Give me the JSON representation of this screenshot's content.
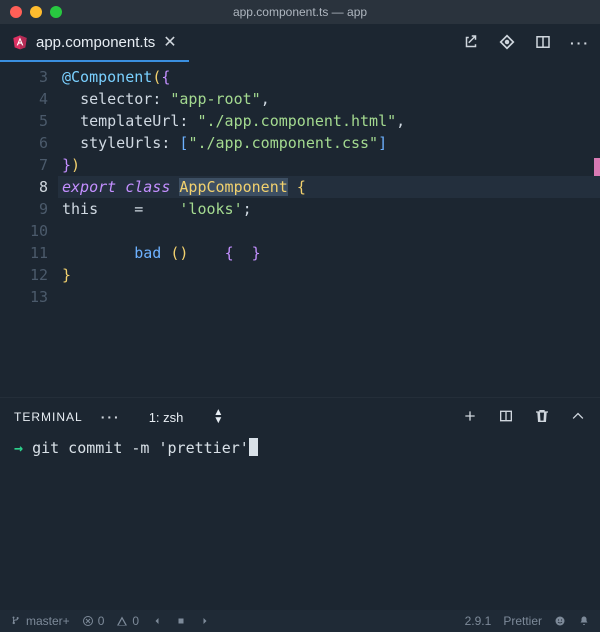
{
  "window": {
    "title": "app.component.ts — app"
  },
  "tab": {
    "filename": "app.component.ts",
    "dirty": false
  },
  "editor": {
    "first_line_number": 3,
    "current_line_number": 8,
    "lines": [
      {
        "n": 3,
        "tokens": [
          [
            "dec",
            "@Component"
          ],
          [
            "brace-y",
            "("
          ],
          [
            "brace-p",
            "{"
          ]
        ]
      },
      {
        "n": 4,
        "tokens": [
          [
            "pun",
            "  "
          ],
          [
            "prop",
            "selector"
          ],
          [
            "pun",
            ": "
          ],
          [
            "str",
            "\"app-root\""
          ],
          [
            "pun",
            ","
          ]
        ]
      },
      {
        "n": 5,
        "tokens": [
          [
            "pun",
            "  "
          ],
          [
            "prop",
            "templateUrl"
          ],
          [
            "pun",
            ": "
          ],
          [
            "str",
            "\"./app.component.html\""
          ],
          [
            "pun",
            ","
          ]
        ]
      },
      {
        "n": 6,
        "tokens": [
          [
            "pun",
            "  "
          ],
          [
            "prop",
            "styleUrls"
          ],
          [
            "pun",
            ": "
          ],
          [
            "brace-b",
            "["
          ],
          [
            "str",
            "\"./app.component.css\""
          ],
          [
            "brace-b",
            "]"
          ]
        ]
      },
      {
        "n": 7,
        "tokens": [
          [
            "brace-p",
            "}"
          ],
          [
            "brace-y",
            ")"
          ]
        ]
      },
      {
        "n": 8,
        "hl": true,
        "tokens": [
          [
            "key",
            "export "
          ],
          [
            "key",
            "class "
          ],
          [
            "type",
            "AppComponent"
          ],
          [
            "pun",
            " "
          ],
          [
            "brace-y",
            "{"
          ]
        ],
        "select": "AppComponent"
      },
      {
        "n": 9,
        "tokens": [
          [
            "prop",
            "this"
          ],
          [
            "pun",
            "    =    "
          ],
          [
            "str",
            "'looks'"
          ],
          [
            "pun",
            ";"
          ]
        ]
      },
      {
        "n": 10,
        "tokens": []
      },
      {
        "n": 11,
        "tokens": [
          [
            "pun",
            "        "
          ],
          [
            "call",
            "bad"
          ],
          [
            "pun",
            " "
          ],
          [
            "brace-y",
            "("
          ],
          [
            "brace-y",
            ")"
          ],
          [
            "pun",
            "    "
          ],
          [
            "brace-p",
            "{"
          ],
          [
            "pun",
            "  "
          ],
          [
            "brace-p",
            "}"
          ]
        ]
      },
      {
        "n": 12,
        "tokens": [
          [
            "brace-y",
            "}"
          ]
        ]
      },
      {
        "n": 13,
        "tokens": []
      }
    ]
  },
  "panel": {
    "title": "TERMINAL",
    "dropdown_label": "1: zsh",
    "prompt_symbol": "→",
    "command": "git commit -m 'prettier'"
  },
  "status": {
    "branch": "master+",
    "errors": "0",
    "warnings": "0",
    "prettier_version": "2.9.1",
    "prettier_label": "Prettier"
  }
}
